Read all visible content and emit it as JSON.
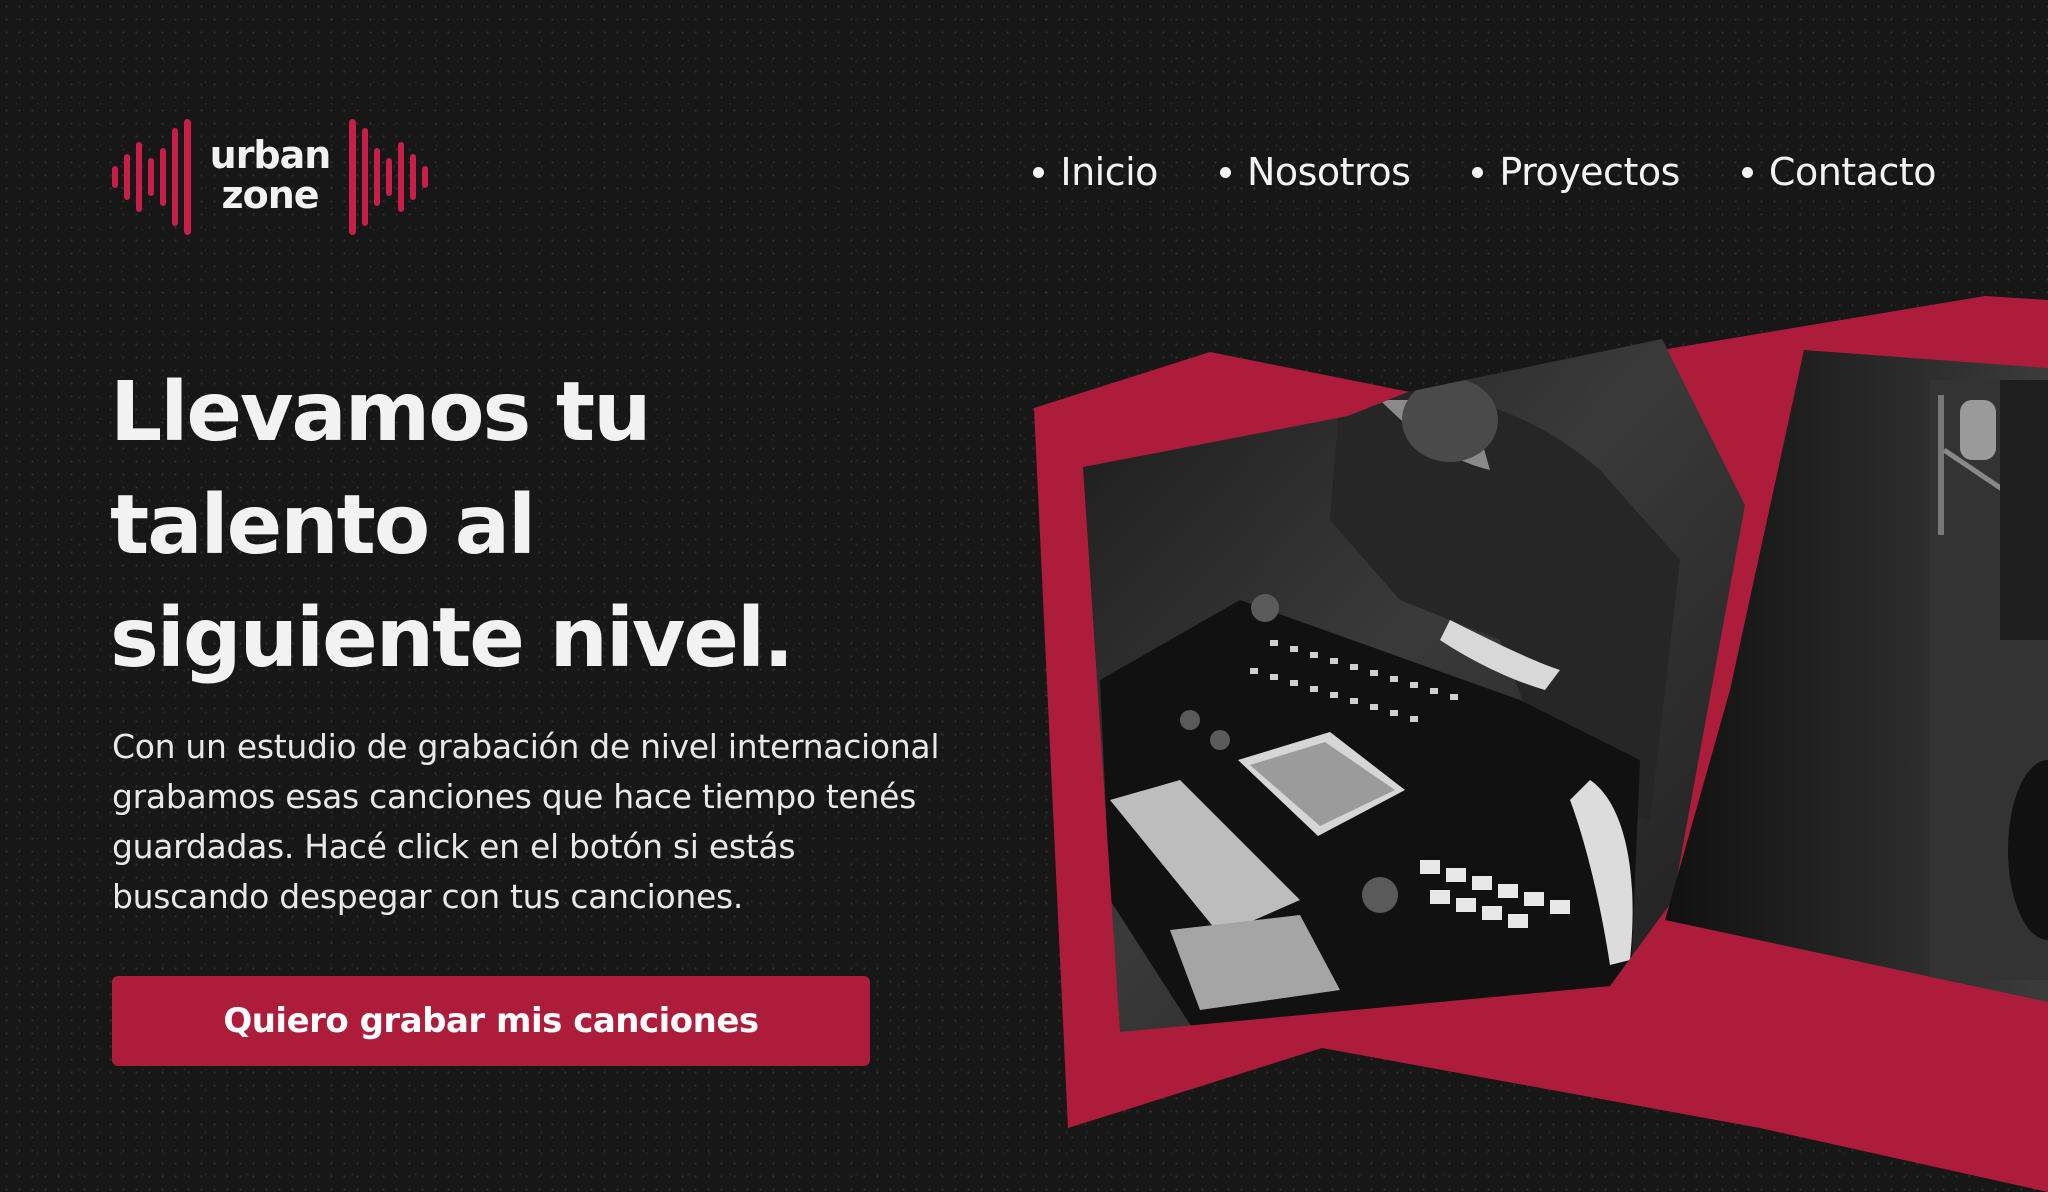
{
  "brand": {
    "line1": "urban",
    "line2": "zone",
    "accent_color": "#ae1c3c",
    "icon": "sound-wave-icon"
  },
  "nav": {
    "items": [
      {
        "label": "Inicio"
      },
      {
        "label": "Nosotros"
      },
      {
        "label": "Proyectos"
      },
      {
        "label": "Contacto"
      }
    ]
  },
  "hero": {
    "headline": [
      "Llevamos tu",
      "talento al",
      "siguiente nivel."
    ],
    "description": [
      "Con un estudio de grabación de nivel internacional",
      "grabamos esas canciones que hace tiempo tenés",
      "guardadas. Hacé click en el botón si estás",
      "buscando despegar con tus canciones."
    ],
    "cta_label": "Quiero grabar mis canciones"
  },
  "images": {
    "primary": "black-and-white photo of a producer working at a mixing console",
    "secondary": "black-and-white photo of a studio microphone"
  }
}
